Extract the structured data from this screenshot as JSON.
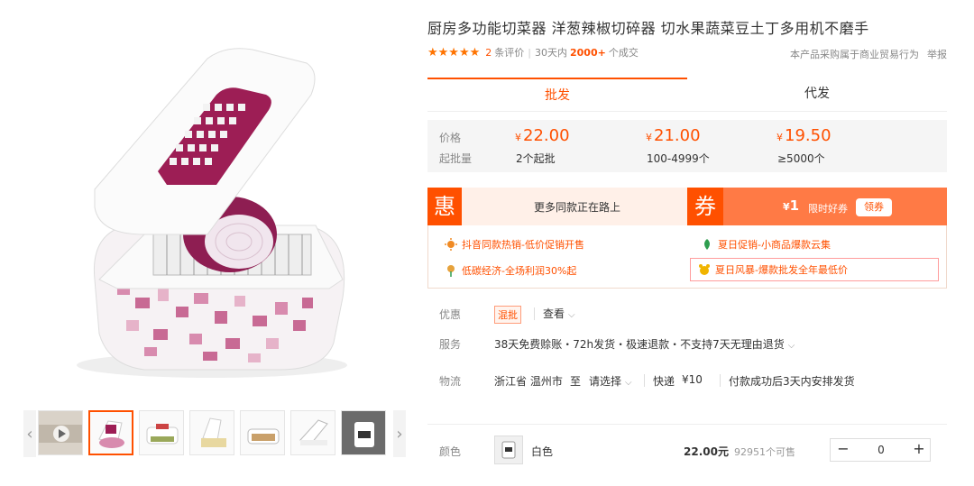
{
  "product": {
    "title": "厨房多功能切菜器 洋葱辣椒切碎器 切水果蔬菜豆土丁多用机不磨手",
    "stars": "★★★★★",
    "review_count": "2",
    "review_label": "条评价",
    "period_label": "30天内",
    "sales_count": "2000+",
    "sales_label": "个成交",
    "trade_note": "本产品采购属于商业贸易行为",
    "report_label": "举报"
  },
  "gallery": {
    "prev_arrow": "‹",
    "next_arrow": "›"
  },
  "tabs": [
    {
      "label": "批发",
      "active": true
    },
    {
      "label": "代发",
      "active": false
    }
  ],
  "pricing": {
    "price_label": "价格",
    "moq_label": "起批量",
    "currency": "¥",
    "tiers": [
      {
        "price": "22.00",
        "qty": "2个起批"
      },
      {
        "price": "21.00",
        "qty": "100-4999个"
      },
      {
        "price": "19.50",
        "qty": "≥5000个"
      }
    ]
  },
  "promo": {
    "hui_tag": "惠",
    "hui_text": "更多同款正在路上",
    "quan_tag": "券",
    "coupon_currency": "¥",
    "coupon_amount": "1",
    "coupon_label": "限时好券",
    "coupon_button": "领券",
    "items": [
      {
        "text": "抖音同款热销-低价促销开售",
        "icon": "sun-icon",
        "color": "#f08a24"
      },
      {
        "text": "夏日促销-小商品爆款云集",
        "icon": "leaf-icon",
        "color": "#2e9e4f"
      },
      {
        "text": "低碳经济-全场利润30%起",
        "icon": "flower-icon",
        "color": "#e6a23c"
      },
      {
        "text": "夏日风暴-爆款批发全年最低价",
        "icon": "face-icon",
        "color": "#f0b400"
      }
    ]
  },
  "service": {
    "youhui_label": "优惠",
    "youhui_tag": "混批",
    "view_label": "查看",
    "fuwu_label": "服务",
    "fuwu_text": "38天免费赊账・72h发货・极速退款・不支持7天无理由退货",
    "wuliu_label": "物流",
    "origin": "浙江省 温州市",
    "to_label": "至",
    "destination": "请选择",
    "express": "快递",
    "express_price": "¥10",
    "ship_note": "付款成功后3天内安排发货"
  },
  "sku": {
    "color_label": "颜色",
    "color_name": "白色",
    "price": "22.00元",
    "stock": "92951个可售",
    "minus": "−",
    "quantity": "0",
    "plus": "+"
  },
  "colors": {
    "accent": "#ff5000",
    "coupon_bg": "#ff7a45",
    "price_bg": "#f5f5f5"
  }
}
